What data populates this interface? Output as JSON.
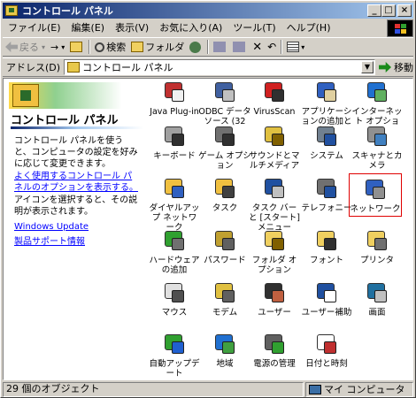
{
  "window": {
    "title": "コントロール パネル",
    "buttons": {
      "minimize": "_",
      "maximize": "□",
      "close": "×"
    }
  },
  "menubar": {
    "items": [
      "ファイル(E)",
      "編集(E)",
      "表示(V)",
      "お気に入り(A)",
      "ツール(T)",
      "ヘルプ(H)"
    ]
  },
  "toolbar": {
    "back": "戻る",
    "forward": "→",
    "search": "検索",
    "folders": "フォルダ"
  },
  "address": {
    "label": "アドレス(D)",
    "value": "コントロール パネル",
    "go": "移動"
  },
  "leftpane": {
    "title": "コントロール パネル",
    "description": "コントロール パネルを使うと、コンピュータの設定を好みに応じて変更できます。",
    "link_common": "よく使用するコントロール パネルのオプションを表示する。",
    "instruction": "アイコンを選択すると、その説明が表示されます。",
    "link_update": "Windows Update",
    "link_support": "製品サポート情報"
  },
  "icons": [
    {
      "label": "Java Plug-in",
      "icon": "java-icon"
    },
    {
      "label": "ODBC データ ソース (32ビ...",
      "icon": "odbc-icon"
    },
    {
      "label": "VirusScan",
      "icon": "virusscan-icon"
    },
    {
      "label": "アプリケーションの追加と削除",
      "icon": "add-remove-icon"
    },
    {
      "label": "インターネット オプション",
      "icon": "internet-icon"
    },
    {
      "label": "キーボード",
      "icon": "keyboard-icon"
    },
    {
      "label": "ゲーム オプション",
      "icon": "game-icon"
    },
    {
      "label": "サウンドとマルチメディア",
      "icon": "sound-icon"
    },
    {
      "label": "システム",
      "icon": "system-icon"
    },
    {
      "label": "スキャナとカメラ",
      "icon": "scanner-icon"
    },
    {
      "label": "ダイヤルアップ ネットワーク",
      "icon": "dialup-icon"
    },
    {
      "label": "タスク",
      "icon": "task-icon"
    },
    {
      "label": "タスク バーと [スタート] メニュー",
      "icon": "taskbar-icon"
    },
    {
      "label": "テレフォニー",
      "icon": "telephony-icon"
    },
    {
      "label": "ネットワーク",
      "icon": "network-icon"
    },
    {
      "label": "ハードウェアの追加",
      "icon": "hardware-icon"
    },
    {
      "label": "パスワード",
      "icon": "password-icon"
    },
    {
      "label": "フォルダ オプション",
      "icon": "folder-options-icon"
    },
    {
      "label": "フォント",
      "icon": "fonts-icon"
    },
    {
      "label": "プリンタ",
      "icon": "printer-icon"
    },
    {
      "label": "マウス",
      "icon": "mouse-icon"
    },
    {
      "label": "モデム",
      "icon": "modem-icon"
    },
    {
      "label": "ユーザー",
      "icon": "users-icon"
    },
    {
      "label": "ユーザー補助",
      "icon": "accessibility-icon"
    },
    {
      "label": "画面",
      "icon": "display-icon"
    },
    {
      "label": "自動アップデート",
      "icon": "auto-update-icon"
    },
    {
      "label": "地域",
      "icon": "regional-icon"
    },
    {
      "label": "電源の管理",
      "icon": "power-icon"
    },
    {
      "label": "日付と時刻",
      "icon": "datetime-icon"
    }
  ],
  "selected_icon": "ネットワーク",
  "statusbar": {
    "count": "29 個のオブジェクト",
    "location": "マイ コンピュータ"
  },
  "colors": {
    "titlebar_start": "#0a246a",
    "titlebar_end": "#a6caf0",
    "selection_highlight": "#e00000",
    "link": "#0000ff"
  }
}
